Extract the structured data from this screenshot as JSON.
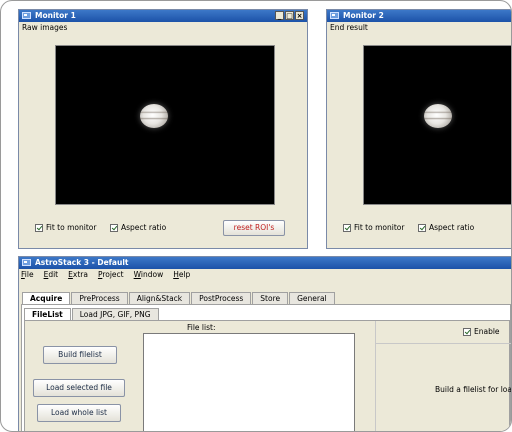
{
  "monitor1": {
    "title": "Monitor 1",
    "caption": "Raw images",
    "buttons": {
      "minimize": "_",
      "maximize": "□",
      "close": "×"
    },
    "fit_label": "Fit to monitor",
    "aspect_label": "Aspect ratio",
    "reset_label": "reset ROI's"
  },
  "monitor2": {
    "title": "Monitor 2",
    "caption": "End result",
    "fit_label": "Fit to monitor",
    "aspect_label": "Aspect ratio"
  },
  "main": {
    "title": "AstroStack 3 - Default",
    "menu": [
      "File",
      "Edit",
      "Extra",
      "Project",
      "Window",
      "Help"
    ],
    "tabs": [
      "Acquire",
      "PreProcess",
      "Align&Stack",
      "PostProcess",
      "Store",
      "General"
    ],
    "active_tab": "Acquire",
    "subtabs": [
      "FileList",
      "Load JPG, GIF, PNG"
    ],
    "active_subtab": "FileList",
    "file_list_label": "File list:",
    "build_filelist": "Build filelist",
    "load_selected": "Load selected file",
    "load_whole": "Load whole list",
    "enable_label": "Enable",
    "hint": "Build a filelist for loa"
  }
}
